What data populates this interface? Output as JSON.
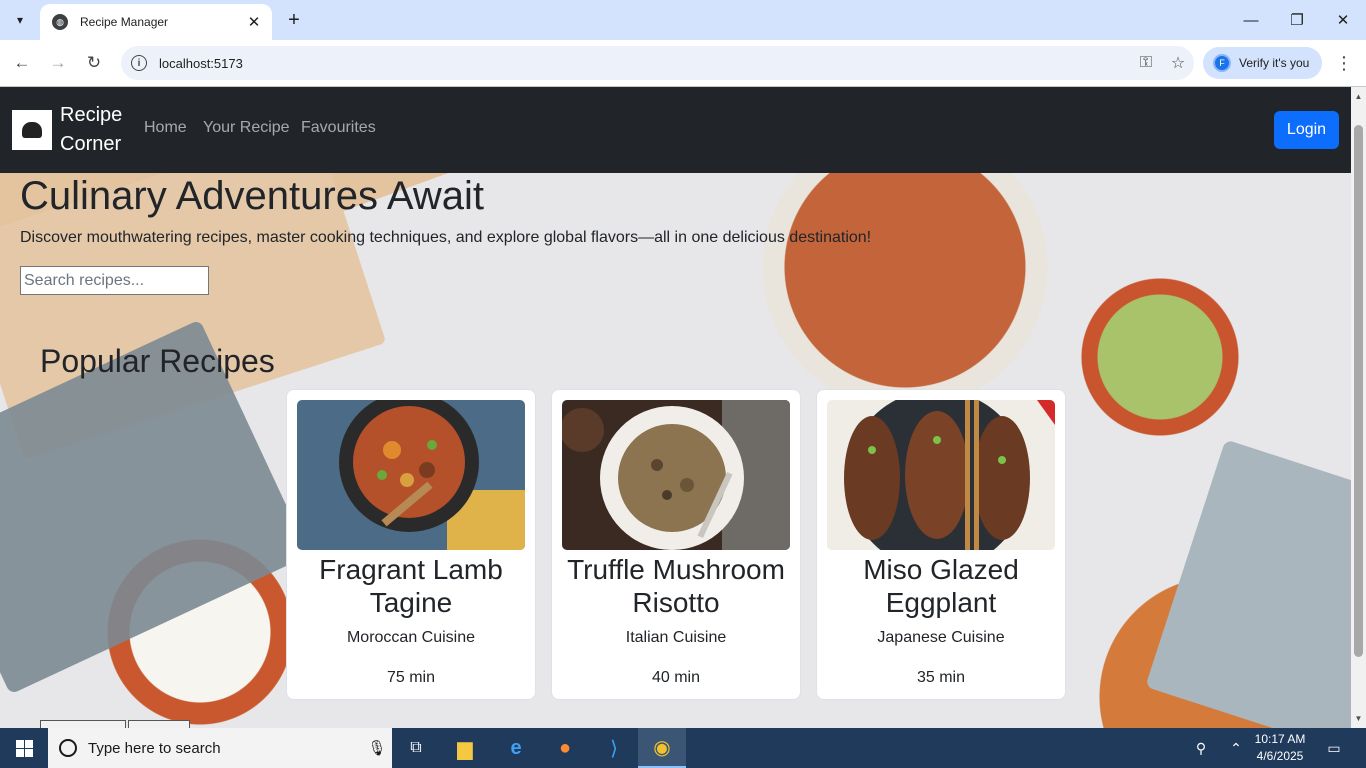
{
  "browser": {
    "tab_title": "Recipe Manager",
    "url": "localhost:5173",
    "verify_label": "Verify it's you",
    "avatar_letter": "F"
  },
  "navbar": {
    "brand_line1": "Recipe",
    "brand_line2": "Corner",
    "links": [
      "Home",
      "Your Recipe",
      "Favourites"
    ],
    "login_label": "Login"
  },
  "hero": {
    "title": "Culinary Adventures Await",
    "subtitle": "Discover mouthwatering recipes, master cooking techniques, and explore global flavors—all in one delicious destination!",
    "search_placeholder": "Search recipes..."
  },
  "popular": {
    "heading": "Popular Recipes",
    "cards": [
      {
        "title": "Fragrant Lamb Tagine",
        "cuisine": "Moroccan Cuisine",
        "time": "75 min"
      },
      {
        "title": "Truffle Mushroom Risotto",
        "cuisine": "Italian Cuisine",
        "time": "40 min"
      },
      {
        "title": "Miso Glazed Eggplant",
        "cuisine": "Japanese Cuisine",
        "time": "35 min"
      }
    ]
  },
  "taskbar": {
    "search_placeholder": "Type here to search",
    "time": "10:17 AM",
    "date": "4/6/2025"
  },
  "colors": {
    "navbar_bg": "#212529",
    "login_button": "#0d6efd",
    "tab_strip": "#d3e3fd",
    "taskbar": "#1f3a5a"
  }
}
